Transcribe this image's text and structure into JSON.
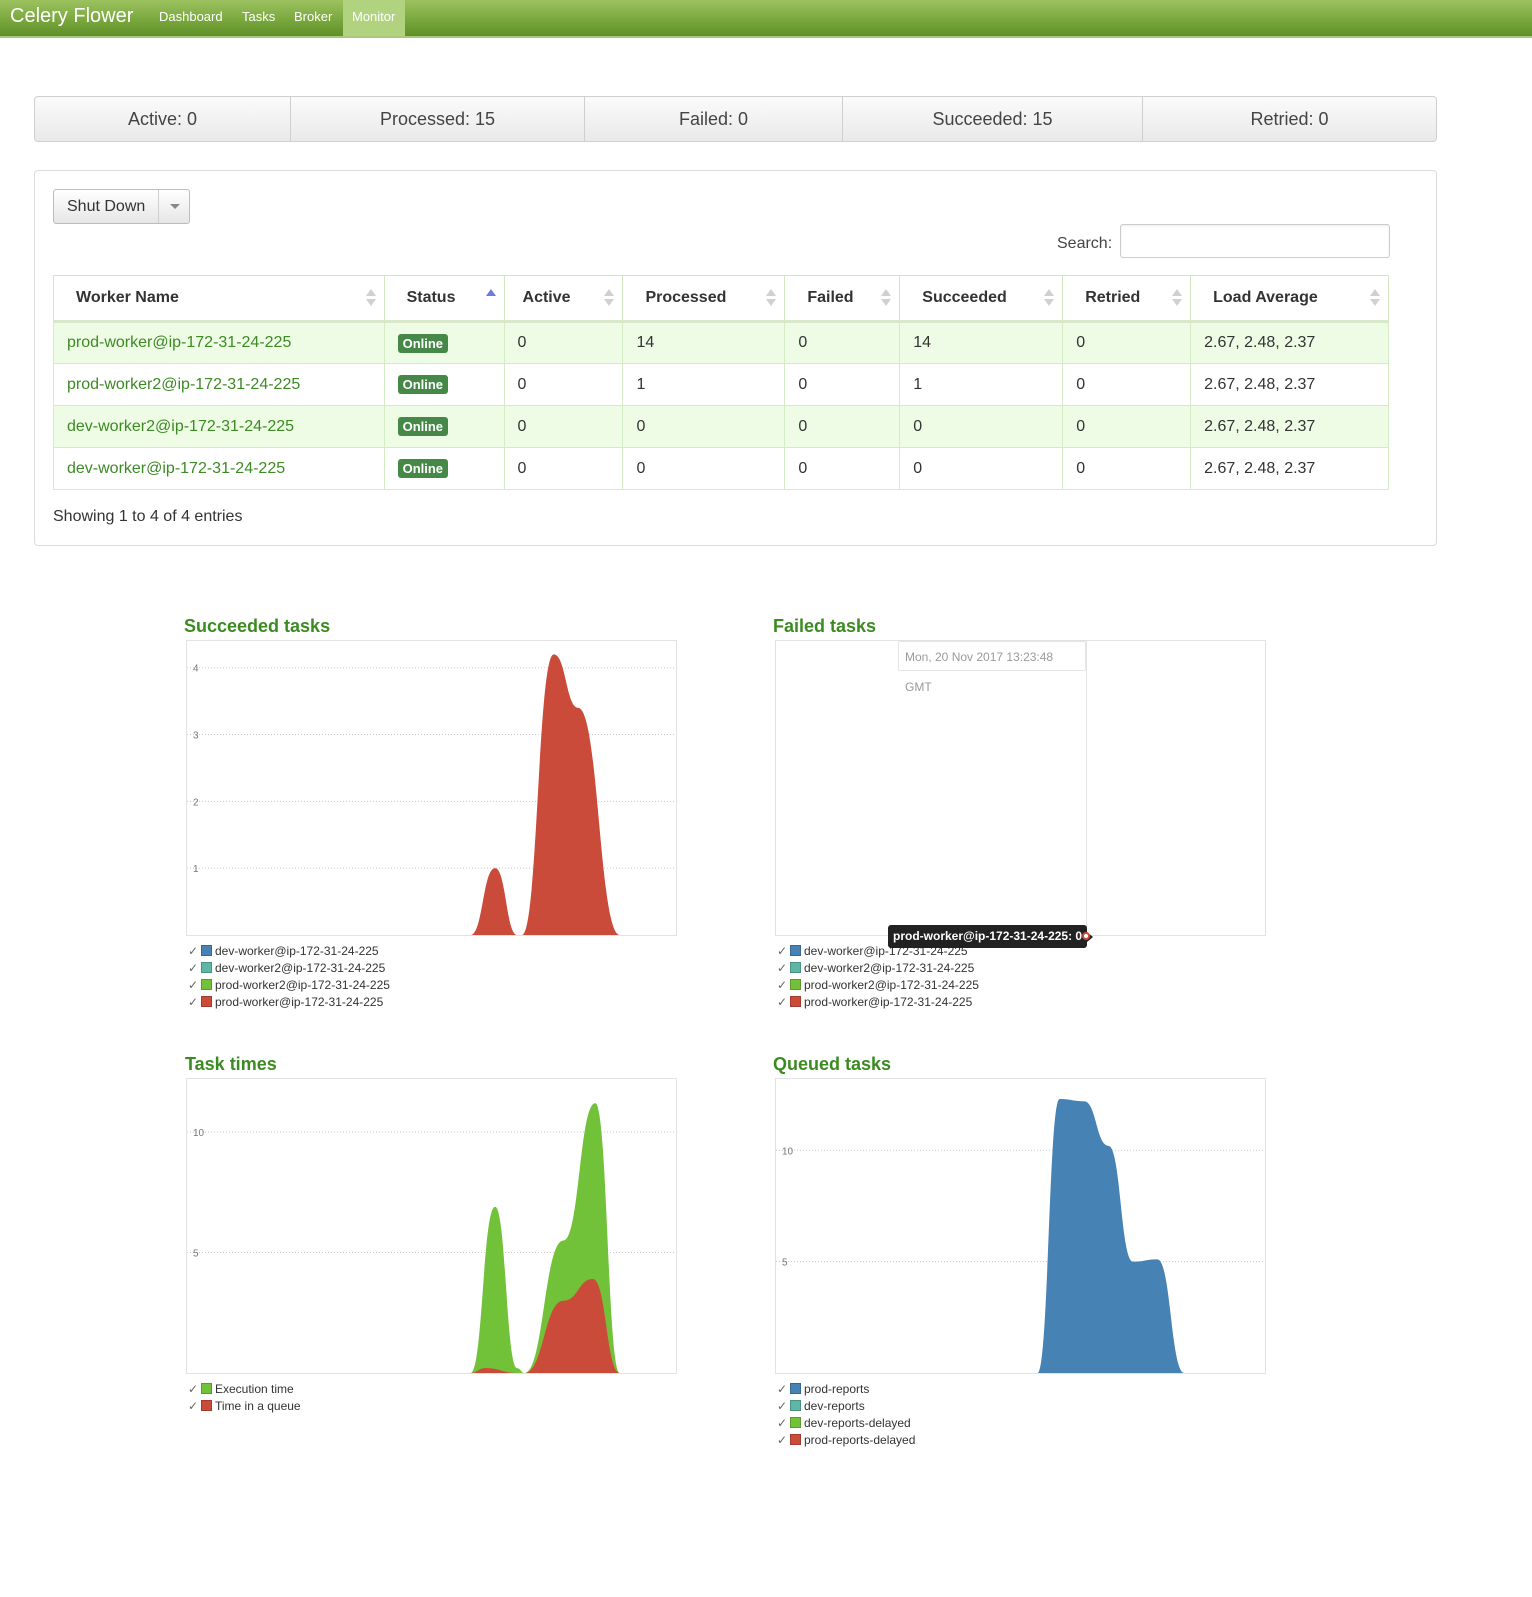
{
  "app": {
    "brand": "Celery Flower",
    "nav": [
      "Dashboard",
      "Tasks",
      "Broker",
      "Monitor"
    ],
    "active_nav": "Monitor"
  },
  "stats": [
    "Active: 0",
    "Processed: 15",
    "Failed: 0",
    "Succeeded: 15",
    "Retried: 0"
  ],
  "workers_panel": {
    "shutdown_label": "Shut Down",
    "search_label": "Search:",
    "search_value": "",
    "columns": [
      "Worker Name",
      "Status",
      "Active",
      "Processed",
      "Failed",
      "Succeeded",
      "Retried",
      "Load Average"
    ],
    "sorted_column": "Status",
    "rows": [
      {
        "name": "prod-worker@ip-172-31-24-225",
        "status": "Online",
        "active": "0",
        "processed": "14",
        "failed": "0",
        "succeeded": "14",
        "retried": "0",
        "load": "2.67, 2.48, 2.37"
      },
      {
        "name": "prod-worker2@ip-172-31-24-225",
        "status": "Online",
        "active": "0",
        "processed": "1",
        "failed": "0",
        "succeeded": "1",
        "retried": "0",
        "load": "2.67, 2.48, 2.37"
      },
      {
        "name": "dev-worker2@ip-172-31-24-225",
        "status": "Online",
        "active": "0",
        "processed": "0",
        "failed": "0",
        "succeeded": "0",
        "retried": "0",
        "load": "2.67, 2.48, 2.37"
      },
      {
        "name": "dev-worker@ip-172-31-24-225",
        "status": "Online",
        "active": "0",
        "processed": "0",
        "failed": "0",
        "succeeded": "0",
        "retried": "0",
        "load": "2.67, 2.48, 2.37"
      }
    ],
    "footer": "Showing 1 to 4 of 4 entries"
  },
  "colors": {
    "navbar": "#7aa83e",
    "title_green": "#3b8b21",
    "badge_green": "#468847",
    "row_shade": "#eefce6",
    "series_blue": "#4682b4",
    "series_teal": "#5eb7a4",
    "series_green": "#72c239",
    "series_red": "#cb4b3a"
  },
  "chart_data": [
    {
      "type": "area",
      "title": "Succeeded tasks",
      "ylim": [
        0,
        4.4
      ],
      "yticks": [
        1,
        2,
        3,
        4
      ],
      "grid": true,
      "legend_position": "bottom",
      "series": [
        {
          "name": "dev-worker@ip-172-31-24-225",
          "color": "#4682b4",
          "points": []
        },
        {
          "name": "dev-worker2@ip-172-31-24-225",
          "color": "#5eb7a4",
          "points": []
        },
        {
          "name": "prod-worker2@ip-172-31-24-225",
          "color": "#72c239",
          "points": []
        },
        {
          "name": "prod-worker@ip-172-31-24-225",
          "color": "#cb4b3a",
          "points": [
            [
              0,
              0
            ],
            [
              0.58,
              0
            ],
            [
              0.63,
              1
            ],
            [
              0.675,
              0
            ],
            [
              0.685,
              0
            ],
            [
              0.75,
              4.2
            ],
            [
              0.8,
              3.4
            ],
            [
              0.885,
              0
            ],
            [
              1,
              0
            ]
          ]
        }
      ]
    },
    {
      "type": "area",
      "title": "Failed tasks",
      "ylim": [
        0,
        1
      ],
      "yticks": [],
      "grid": false,
      "legend_position": "bottom",
      "hover_time": "Mon, 20 Nov 2017 13:23:48 GMT",
      "tooltip": "prod-worker@ip-172-31-24-225: 0",
      "series": [
        {
          "name": "dev-worker@ip-172-31-24-225",
          "color": "#4682b4",
          "points": []
        },
        {
          "name": "dev-worker2@ip-172-31-24-225",
          "color": "#5eb7a4",
          "points": []
        },
        {
          "name": "prod-worker2@ip-172-31-24-225",
          "color": "#72c239",
          "points": []
        },
        {
          "name": "prod-worker@ip-172-31-24-225",
          "color": "#cb4b3a",
          "points": []
        }
      ]
    },
    {
      "type": "area",
      "title": "Task times",
      "ylim": [
        0,
        12.2
      ],
      "yticks": [
        5,
        10
      ],
      "grid": true,
      "legend_position": "bottom",
      "series": [
        {
          "name": "Execution time",
          "color": "#72c239",
          "points": [
            [
              0,
              0
            ],
            [
              0.58,
              0
            ],
            [
              0.63,
              6.9
            ],
            [
              0.675,
              0.2
            ],
            [
              0.69,
              0
            ],
            [
              0.77,
              5.5
            ],
            [
              0.835,
              11.2
            ],
            [
              0.885,
              0
            ],
            [
              1,
              0
            ]
          ]
        },
        {
          "name": "Time in a queue",
          "color": "#cb4b3a",
          "points": [
            [
              0,
              0
            ],
            [
              0.58,
              0
            ],
            [
              0.61,
              0.2
            ],
            [
              0.675,
              0
            ],
            [
              0.69,
              0
            ],
            [
              0.77,
              3.0
            ],
            [
              0.83,
              3.9
            ],
            [
              0.885,
              0
            ],
            [
              1,
              0
            ]
          ]
        }
      ]
    },
    {
      "type": "area",
      "title": "Queued tasks",
      "ylim": [
        0,
        13.2
      ],
      "yticks": [
        5,
        10
      ],
      "grid": true,
      "legend_position": "bottom",
      "series": [
        {
          "name": "prod-reports",
          "color": "#4682b4",
          "points": [
            [
              0,
              0
            ],
            [
              0.535,
              0
            ],
            [
              0.58,
              12.3
            ],
            [
              0.63,
              12.2
            ],
            [
              0.68,
              10.2
            ],
            [
              0.73,
              5.0
            ],
            [
              0.78,
              5.1
            ],
            [
              0.835,
              0
            ],
            [
              1,
              0
            ]
          ]
        },
        {
          "name": "dev-reports",
          "color": "#5eb7a4",
          "points": []
        },
        {
          "name": "dev-reports-delayed",
          "color": "#72c239",
          "points": []
        },
        {
          "name": "prod-reports-delayed",
          "color": "#cb4b3a",
          "points": []
        }
      ]
    }
  ]
}
